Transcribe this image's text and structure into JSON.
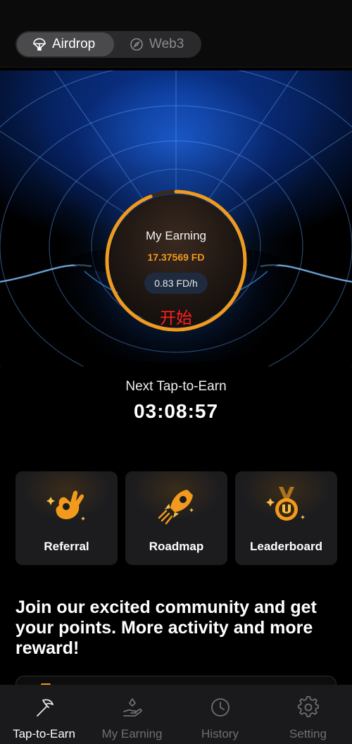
{
  "top_tabs": [
    {
      "label": "Airdrop",
      "icon": "parachute-icon",
      "active": true
    },
    {
      "label": "Web3",
      "icon": "compass-icon",
      "active": false
    }
  ],
  "earning": {
    "title": "My Earning",
    "amount": "17.37569 FD",
    "rate": "0.83 FD/h",
    "start_label": "开始",
    "ring_progress": 0.94,
    "accent": "#f29a1c"
  },
  "next_tap": {
    "label": "Next Tap-to-Earn",
    "countdown": "03:08:57"
  },
  "features": [
    {
      "label": "Referral",
      "icon": "ok-hand-icon"
    },
    {
      "label": "Roadmap",
      "icon": "rocket-icon"
    },
    {
      "label": "Leaderboard",
      "icon": "medal-icon"
    }
  ],
  "promo_text": "Join our excited community and get your points. More activity and more reward!",
  "bottom_nav": [
    {
      "label": "Tap-to-Earn",
      "icon": "pickaxe-icon",
      "active": true
    },
    {
      "label": "My Earning",
      "icon": "hand-coin-icon",
      "active": false
    },
    {
      "label": "History",
      "icon": "clock-icon",
      "active": false
    },
    {
      "label": "Setting",
      "icon": "gear-icon",
      "active": false
    }
  ]
}
